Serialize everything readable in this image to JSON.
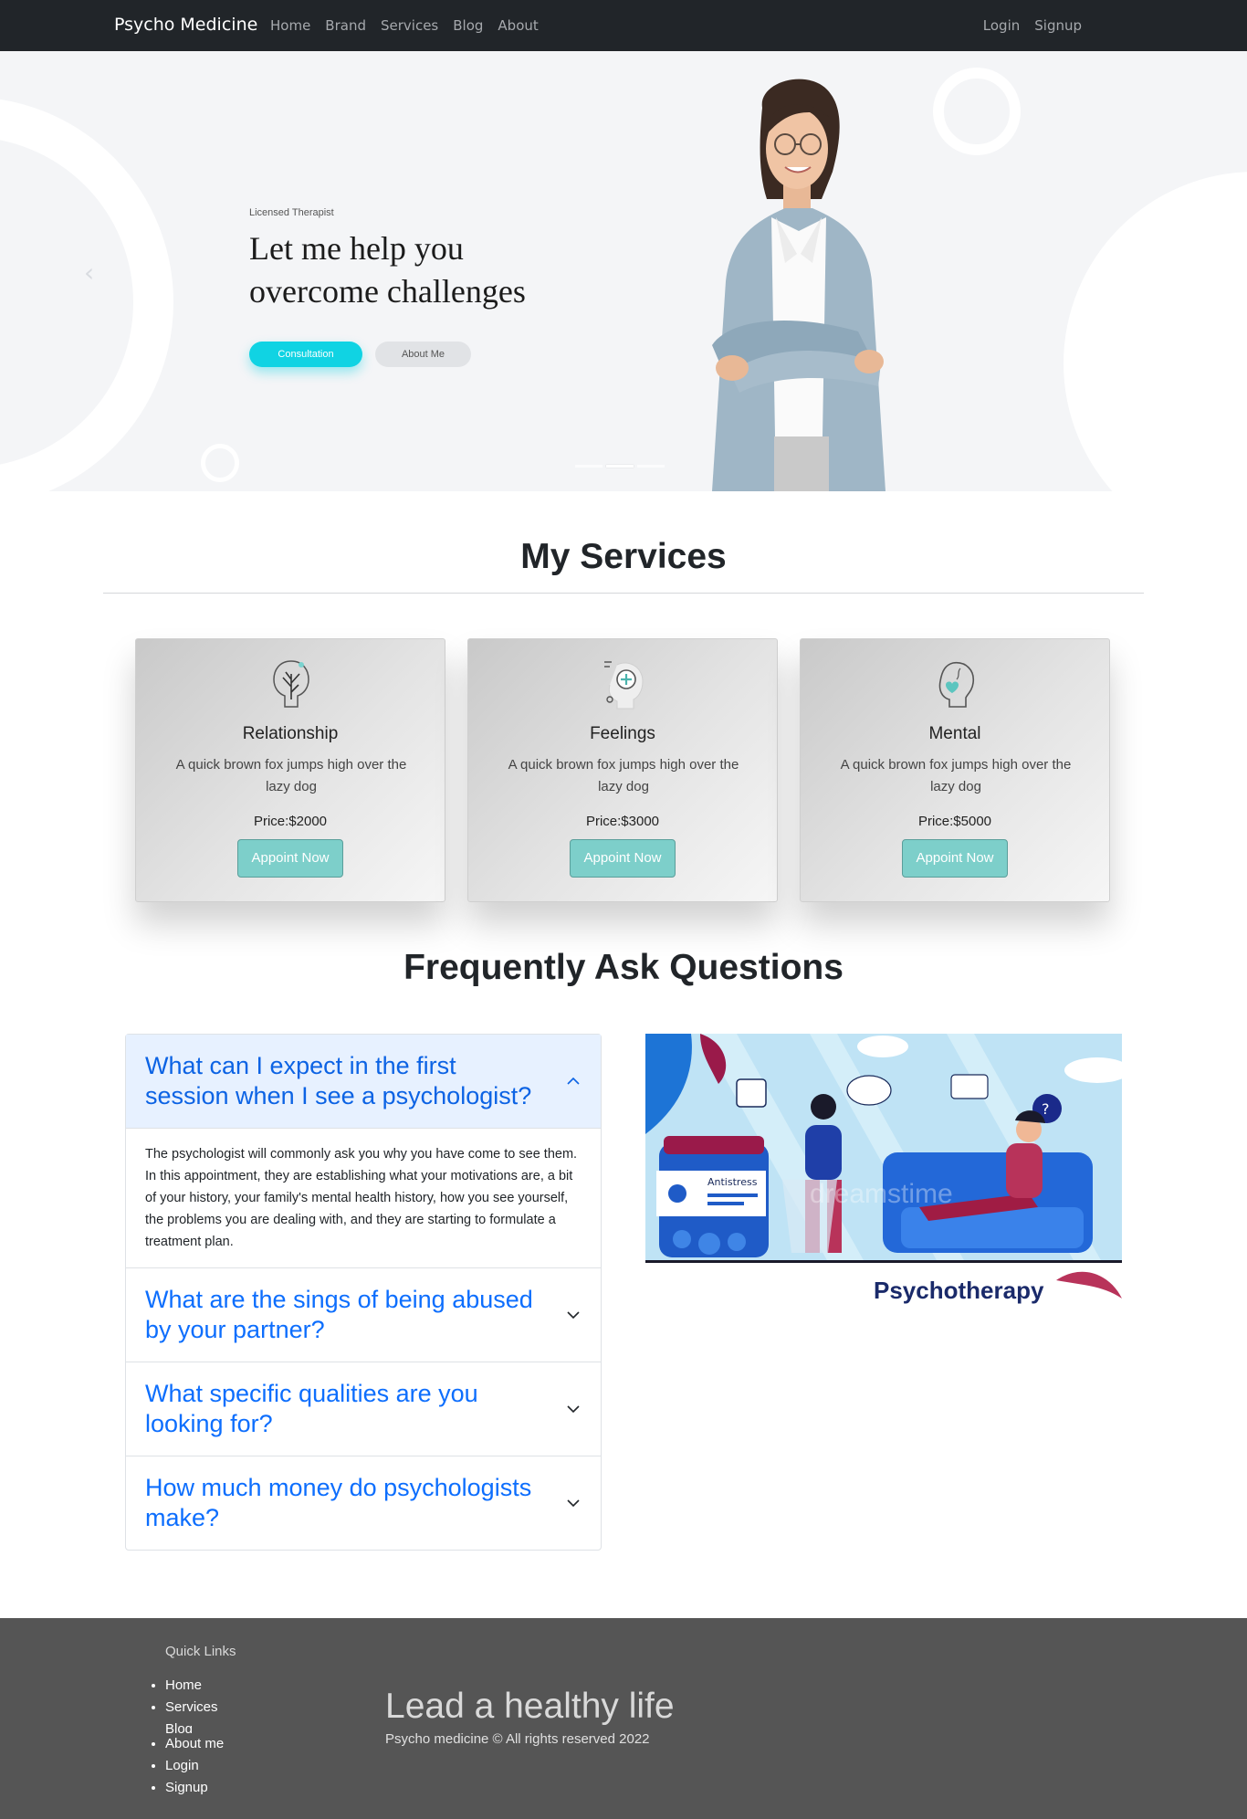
{
  "navbar": {
    "brand": "Psycho Medicine",
    "links": [
      "Home",
      "Brand",
      "Services",
      "Blog",
      "About"
    ],
    "auth": [
      "Login",
      "Signup"
    ]
  },
  "hero": {
    "kicker": "Licensed Therapist",
    "title": "Let me help you\novercome challenges",
    "consult_label": "Consultation",
    "about_label": "About Me",
    "prev_icon": "chevron-left-icon",
    "slide_count": 3,
    "active_slide": 2
  },
  "services": {
    "title": "My Services",
    "cards": [
      {
        "icon": "tree-head-icon",
        "title": "Relationship",
        "desc": "A quick brown fox jumps high over the lazy dog",
        "price": "Price:$2000",
        "button": "Appoint Now"
      },
      {
        "icon": "head-plus-icon",
        "title": "Feelings",
        "desc": "A quick brown fox jumps high over the lazy dog",
        "price": "Price:$3000",
        "button": "Appoint Now"
      },
      {
        "icon": "head-heart-icon",
        "title": "Mental",
        "desc": "A quick brown fox jumps high over the lazy dog",
        "price": "Price:$5000",
        "button": "Appoint Now"
      }
    ]
  },
  "faq": {
    "title": "Frequently Ask Questions",
    "items": [
      {
        "q": "What can I expect in the first session when I see a psychologist?",
        "a": "The psychologist will commonly ask you why you have come to see them. In this appointment, they are establishing what your motivations are, a bit of your history, your family's mental health history, how you see yourself, the problems you are dealing with, and they are starting to formulate a treatment plan.",
        "open": true
      },
      {
        "q": "What are the sings of being abused by your partner?",
        "open": false
      },
      {
        "q": "What specific qualities are you looking for?",
        "open": false
      },
      {
        "q": "How much money do psychologists make?",
        "open": false
      }
    ],
    "image": {
      "caption": "Psychotherapy",
      "jar_label": "Antistress",
      "watermark": "dreamstime"
    }
  },
  "footer": {
    "quick_links_title": "Quick Links",
    "links": [
      "Home",
      "Services",
      "Blog",
      "About me",
      "Login",
      "Signup"
    ],
    "tagline": "Lead a healthy life",
    "copyright": "Psycho medicine © All rights reserved 2022"
  },
  "colors": {
    "navbar": "#212529",
    "accent_cyan": "#10d3e3",
    "appoint_button": "#7dcfca",
    "faq_link": "#0d6efd",
    "footer": "#555555"
  }
}
